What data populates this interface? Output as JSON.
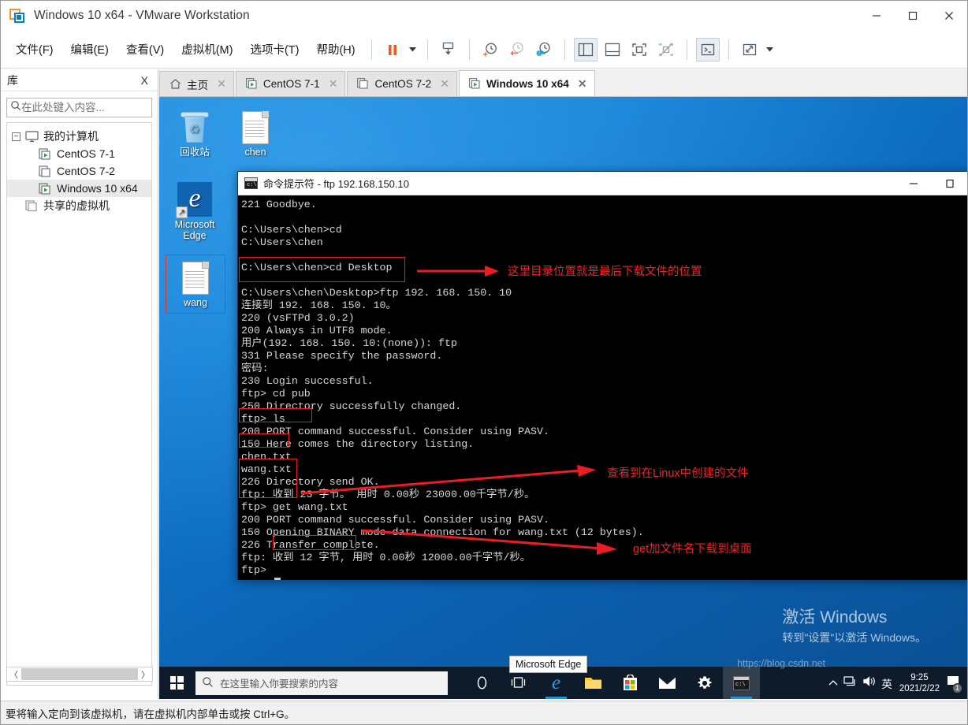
{
  "window": {
    "title": "Windows 10 x64 - VMware Workstation",
    "minimize": "minimize-icon",
    "maximize": "maximize-icon",
    "close": "close-icon"
  },
  "menubar": {
    "items": [
      {
        "label": "文件(F)",
        "name": "menu-file"
      },
      {
        "label": "编辑(E)",
        "name": "menu-edit"
      },
      {
        "label": "查看(V)",
        "name": "menu-view"
      },
      {
        "label": "虚拟机(M)",
        "name": "menu-vm"
      },
      {
        "label": "选项卡(T)",
        "name": "menu-tabs"
      },
      {
        "label": "帮助(H)",
        "name": "menu-help"
      }
    ],
    "toolbar": [
      {
        "name": "suspend-button",
        "icon": "pause-icon"
      },
      {
        "name": "suspend-dropdown",
        "icon": "chevron-down-icon"
      },
      {
        "name": "power-button",
        "icon": "power-down-icon"
      },
      {
        "name": "snapshot-take-button",
        "icon": "snapshot-add-icon"
      },
      {
        "name": "snapshot-revert-button",
        "icon": "snapshot-revert-icon"
      },
      {
        "name": "snapshot-manager-button",
        "icon": "snapshot-manager-icon"
      },
      {
        "name": "show-library-button",
        "icon": "panel-left-icon"
      },
      {
        "name": "show-thumbnail-bar-button",
        "icon": "panel-bottom-icon"
      },
      {
        "name": "fullscreen-button",
        "icon": "fullscreen-icon"
      },
      {
        "name": "unity-button",
        "icon": "unity-icon"
      },
      {
        "name": "console-button",
        "icon": "terminal-icon"
      },
      {
        "name": "stretch-button",
        "icon": "expand-arrows-icon"
      },
      {
        "name": "stretch-dropdown",
        "icon": "chevron-down-icon"
      }
    ]
  },
  "sidebar": {
    "title": "库",
    "close_label": "X",
    "search_placeholder": "在此处键入内容...",
    "search_value": "",
    "tree": [
      {
        "label": "我的计算机",
        "name": "sidebar-item-my-computer",
        "level": 0,
        "icon": "monitor-icon",
        "expander": "−",
        "selected": false
      },
      {
        "label": "CentOS 7-1",
        "name": "sidebar-item-centos-7-1",
        "level": 1,
        "icon": "vm-running-icon",
        "selected": false
      },
      {
        "label": "CentOS 7-2",
        "name": "sidebar-item-centos-7-2",
        "level": 1,
        "icon": "vm-off-icon",
        "selected": false
      },
      {
        "label": "Windows 10 x64",
        "name": "sidebar-item-windows-10-x64",
        "level": 1,
        "icon": "vm-running-icon",
        "selected": true
      },
      {
        "label": "共享的虚拟机",
        "name": "sidebar-item-shared-vms",
        "level": 0,
        "icon": "shared-vm-icon",
        "selected": false
      }
    ]
  },
  "tabs": [
    {
      "label": "主页",
      "name": "tab-home",
      "icon": "home-icon",
      "active": false
    },
    {
      "label": "CentOS 7-1",
      "name": "tab-centos-7-1",
      "icon": "vm-running-icon",
      "active": false
    },
    {
      "label": "CentOS 7-2",
      "name": "tab-centos-7-2",
      "icon": "vm-off-icon",
      "active": false
    },
    {
      "label": "Windows 10 x64",
      "name": "tab-windows-10-x64",
      "icon": "vm-running-icon",
      "active": true
    }
  ],
  "desktop": {
    "icons": [
      {
        "label": "回收站",
        "name": "desktop-icon-recycle-bin",
        "icon": "recycle-bin-icon"
      },
      {
        "label": "chen",
        "name": "desktop-icon-chen",
        "icon": "text-file-icon"
      },
      {
        "label": "Microsoft\nEdge",
        "name": "desktop-icon-microsoft-edge",
        "icon": "edge-icon"
      },
      {
        "label": "wang",
        "name": "desktop-icon-wang",
        "icon": "text-file-icon",
        "highlighted": true
      }
    ],
    "edge_line1": "Microsoft",
    "edge_line2": "Edge"
  },
  "cmd": {
    "title": "命令提示符 - ftp  192.168.150.10",
    "minimize": "minimize-icon",
    "maximize": "maximize-icon",
    "lines": [
      "221 Goodbye.",
      "",
      "C:\\Users\\chen>cd",
      "C:\\Users\\chen",
      "",
      "C:\\Users\\chen>cd Desktop",
      "",
      "C:\\Users\\chen\\Desktop>ftp 192. 168. 150. 10",
      "连接到 192. 168. 150. 10。",
      "220 (vsFTPd 3.0.2)",
      "200 Always in UTF8 mode.",
      "用户(192. 168. 150. 10:(none)): ftp",
      "331 Please specify the password.",
      "密码:",
      "230 Login successful.",
      "ftp> cd pub",
      "250 Directory successfully changed.",
      "ftp> ls",
      "200 PORT command successful. Consider using PASV.",
      "150 Here comes the directory listing.",
      "chen.txt",
      "wang.txt",
      "226 Directory send OK.",
      "ftp: 收到 23 字节。 用时 0.00秒 23000.00千字节/秒。",
      "ftp> get wang.txt",
      "200 PORT command successful. Consider using PASV.",
      "150 Opening BINARY mode data connection for wang.txt (12 bytes).",
      "226 Transfer complete.",
      "ftp: 收到 12 字节, 用时 0.00秒 12000.00千字节/秒。",
      "ftp> "
    ]
  },
  "annotations": {
    "color": "#ec1c24",
    "items": [
      {
        "name": "annotation-download-location",
        "text": "这里目录位置就是最后下载文件的位置"
      },
      {
        "name": "annotation-linux-files",
        "text": "查看到在Linux中创建的文件"
      },
      {
        "name": "annotation-get-command",
        "text": "get加文件名下载到桌面"
      }
    ]
  },
  "watermark": {
    "line1": "激活 Windows",
    "line2": "转到\"设置\"以激活 Windows。",
    "url": "https://blog.csdn.net"
  },
  "tooltip": {
    "text": "Microsoft Edge"
  },
  "taskbar": {
    "start": "windows-start-icon",
    "search_placeholder": "在这里输入你要搜索的内容",
    "apps": [
      {
        "name": "taskbar-cortana-icon",
        "icon": "cortana-circle-icon"
      },
      {
        "name": "taskbar-task-view-icon",
        "icon": "task-view-icon"
      },
      {
        "name": "taskbar-edge-icon",
        "icon": "edge-icon"
      },
      {
        "name": "taskbar-file-explorer-icon",
        "icon": "folder-icon"
      },
      {
        "name": "taskbar-store-icon",
        "icon": "store-icon"
      },
      {
        "name": "taskbar-mail-icon",
        "icon": "mail-icon"
      },
      {
        "name": "taskbar-settings-icon",
        "icon": "gear-icon"
      },
      {
        "name": "taskbar-cmd-icon",
        "icon": "terminal-icon"
      }
    ],
    "tray": {
      "chevron": "chevron-up-icon",
      "network": "network-icon",
      "volume": "volume-icon",
      "ime": "英",
      "time": "9:25",
      "date": "2021/2/22",
      "notifications": "notification-icon",
      "notification_count": "1"
    }
  },
  "statusbar": {
    "text": "要将输入定向到该虚拟机，请在虚拟机内部单击或按 Ctrl+G。"
  }
}
